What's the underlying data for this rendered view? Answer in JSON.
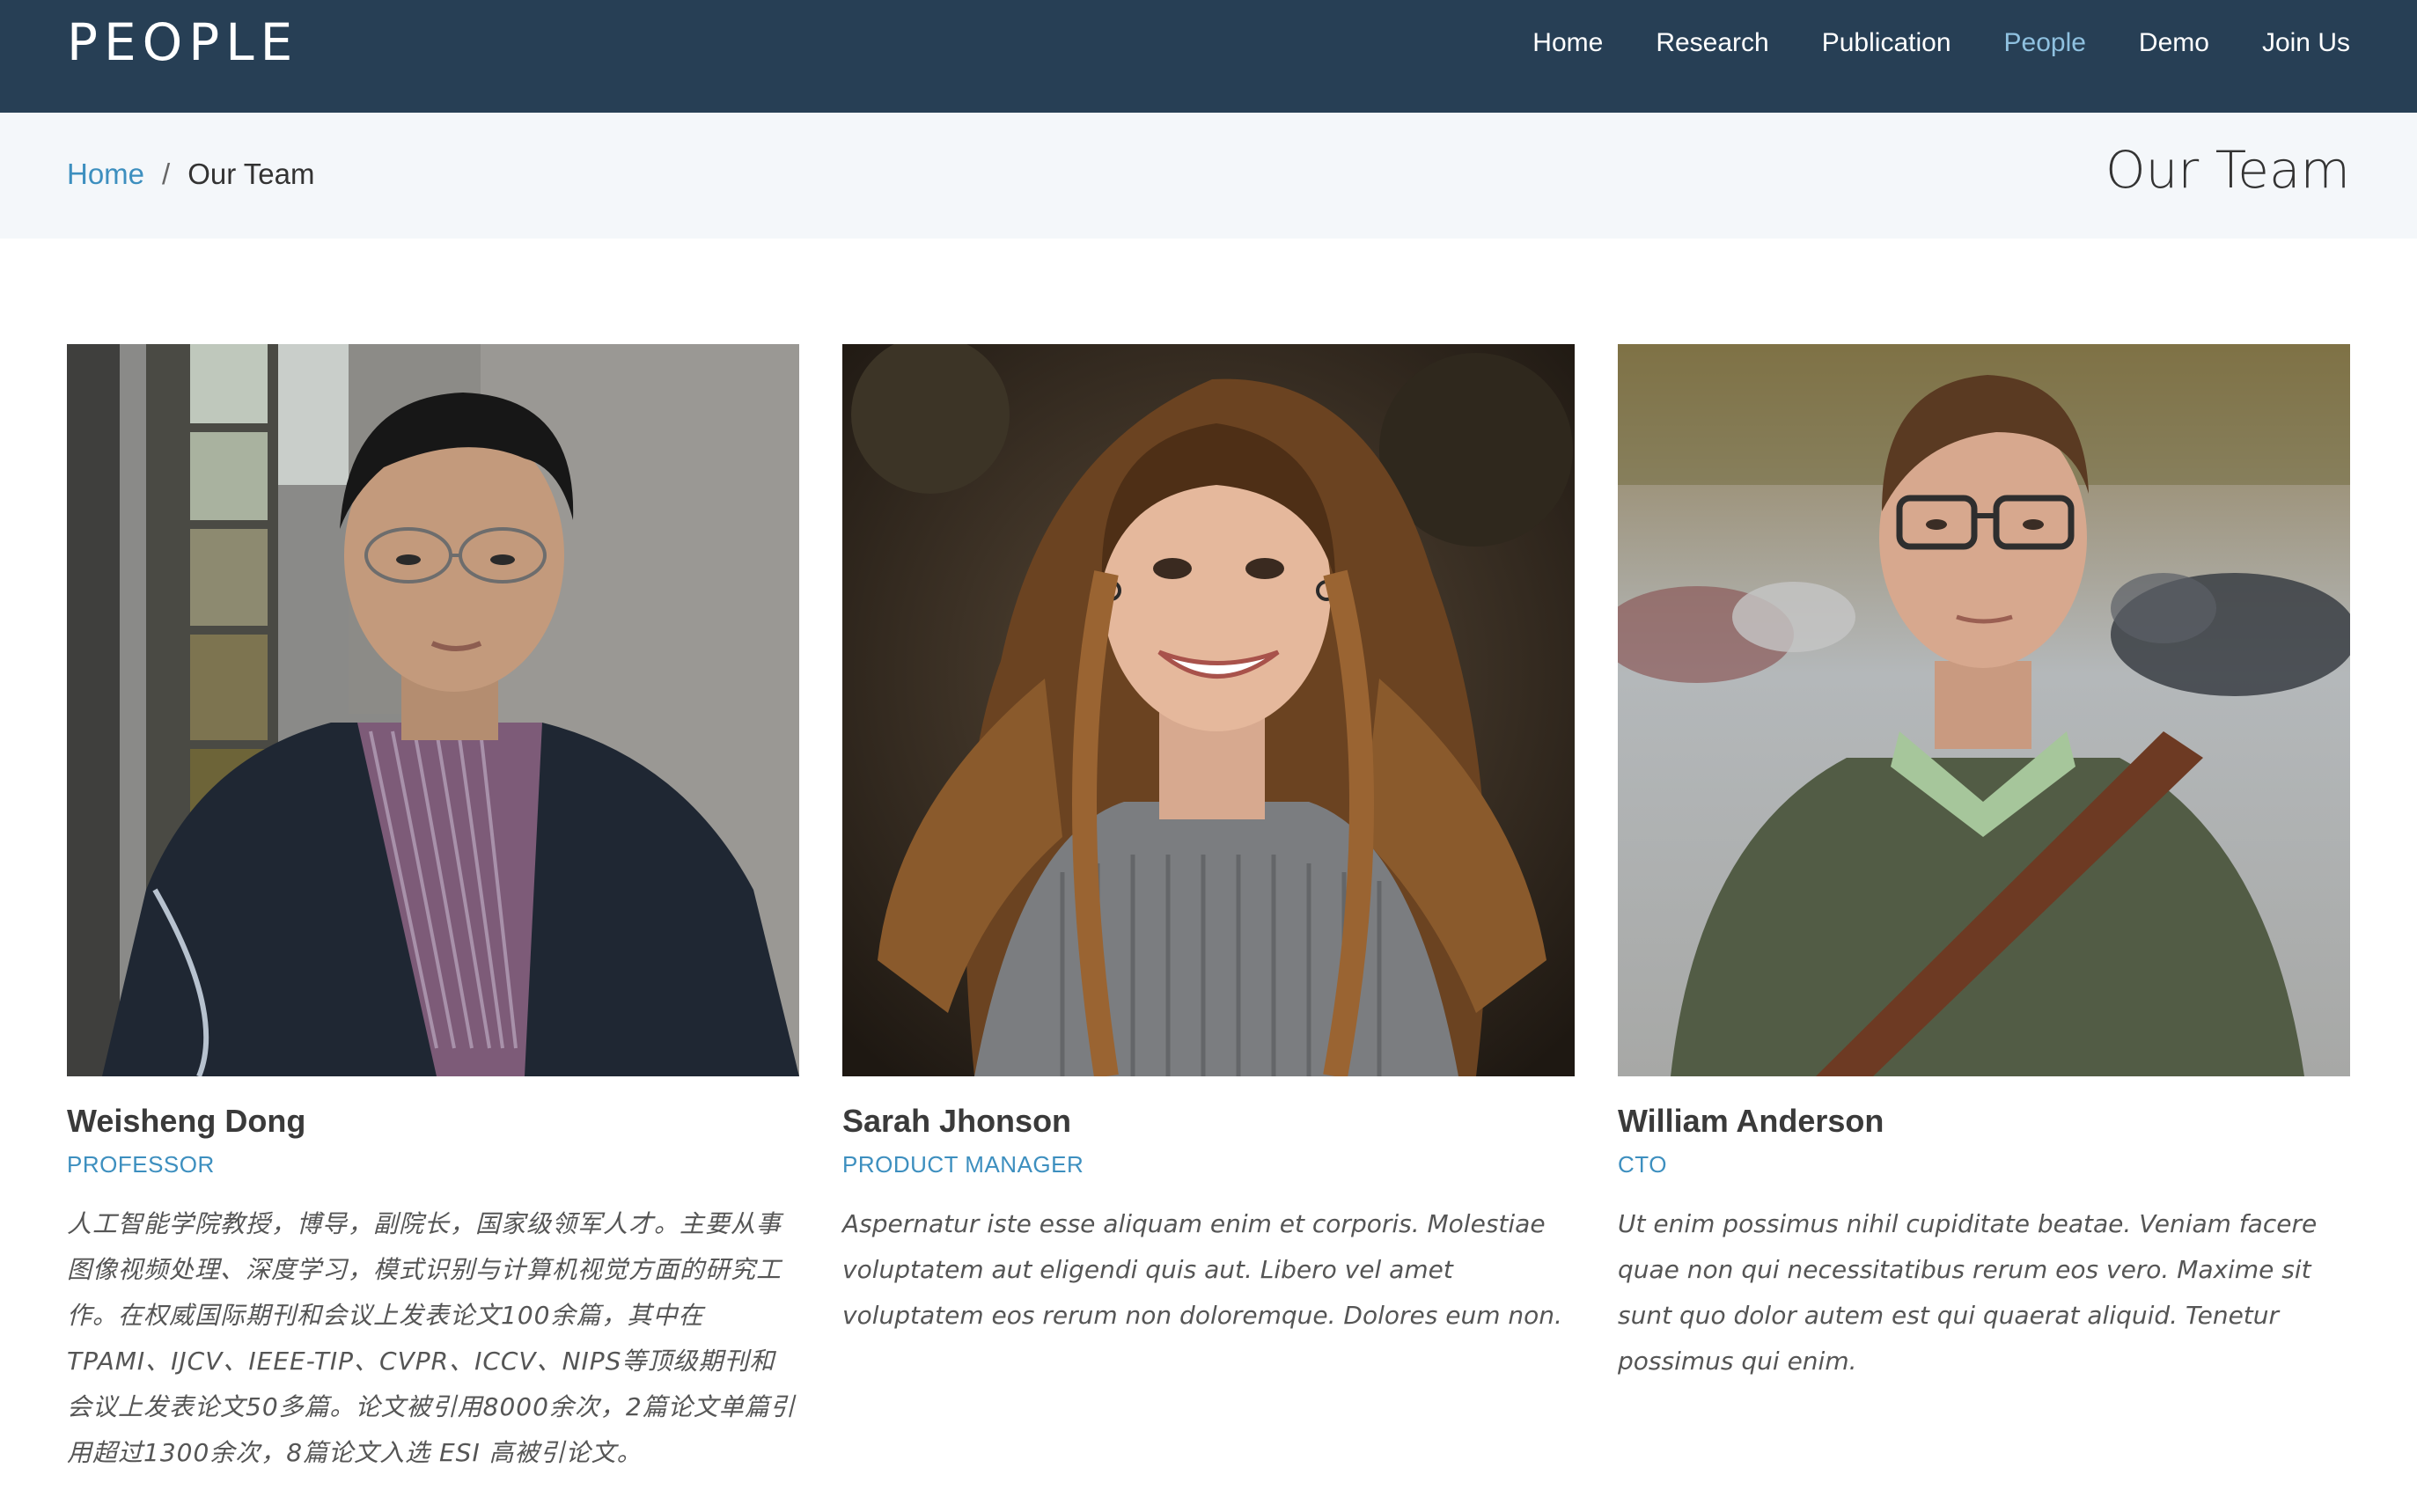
{
  "header": {
    "brand": "PEOPLE",
    "nav": [
      {
        "label": "Home",
        "active": false
      },
      {
        "label": "Research",
        "active": false
      },
      {
        "label": "Publication",
        "active": false
      },
      {
        "label": "People",
        "active": true
      },
      {
        "label": "Demo",
        "active": false
      },
      {
        "label": "Join Us",
        "active": false
      }
    ]
  },
  "breadcrumb": {
    "home": "Home",
    "separator": "/",
    "current": "Our Team"
  },
  "page_title": "Our Team",
  "team": [
    {
      "name": "Weisheng Dong",
      "role": "Professor",
      "bio": "人工智能学院教授，博导，副院长，国家级领军人才。主要从事图像视频处理、深度学习，模式识别与计算机视觉方面的研究工作。在权威国际期刊和会议上发表论文100余篇，其中在TPAMI、IJCV、IEEE-TIP、CVPR、ICCV、NIPS等顶级期刊和会议上发表论文50多篇。论文被引用8000余次，2篇论文单篇引用超过1300余次，8篇论文入选 ESI 高被引论文。"
    },
    {
      "name": "Sarah Jhonson",
      "role": "Product Manager",
      "bio": "Aspernatur iste esse aliquam enim et corporis. Molestiae voluptatem aut eligendi quis aut. Libero vel amet voluptatem eos rerum non doloremque. Dolores eum non."
    },
    {
      "name": "William Anderson",
      "role": "CTO",
      "bio": "Ut enim possimus nihil cupiditate beatae. Veniam facere quae non qui necessitatibus rerum eos vero. Maxime sit sunt quo dolor autem est qui quaerat aliquid. Tenetur possimus qui enim."
    }
  ],
  "colors": {
    "header_bg": "#273f55",
    "nav_active": "#8fc1e0",
    "accent": "#3d8fbf",
    "crumb_bg": "#f4f7fa"
  }
}
